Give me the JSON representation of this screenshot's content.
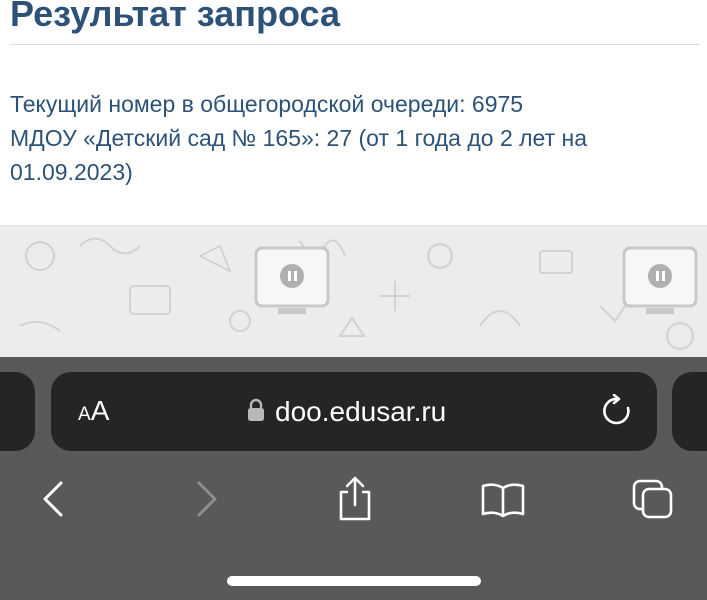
{
  "page": {
    "title": "Результат запроса",
    "result_lines": [
      "Текущий номер в общегородской очереди: 6975",
      "МДОУ «Детский сад № 165»: 27 (от 1 года до 2 лет на",
      "01.09.2023)"
    ]
  },
  "browser": {
    "text_size_button": {
      "label_small": "A",
      "label_large": "A",
      "icon": "text-size-icon"
    },
    "address": {
      "url": "doo.edusar.ru",
      "lock_icon": "lock-icon"
    },
    "reload_icon": "reload-icon",
    "nav": {
      "back_icon": "chevron-left-icon",
      "forward_icon": "chevron-right-icon",
      "share_icon": "share-icon",
      "bookmarks_icon": "book-icon",
      "tabs_icon": "tabs-icon"
    }
  },
  "colors": {
    "heading": "#2d5278",
    "toolbar": "#595959",
    "address_bar": "#252525",
    "disabled_icon": "#8e8e8e"
  }
}
